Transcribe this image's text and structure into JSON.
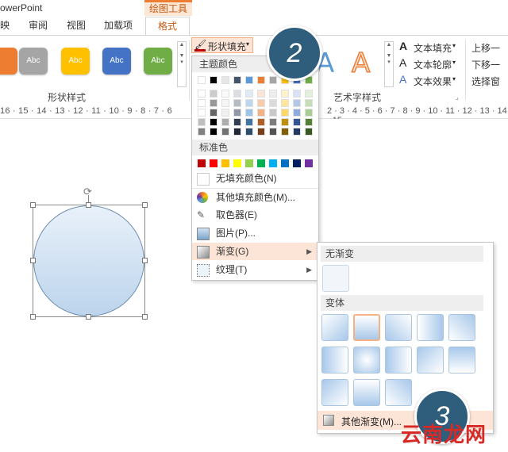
{
  "app": {
    "title": "owerPoint",
    "contextual_group": "绘图工具"
  },
  "tabs": [
    "映",
    "审阅",
    "视图",
    "加载项"
  ],
  "active_tab": "格式",
  "shape_styles": {
    "group_label": "形状样式",
    "buttons": [
      {
        "label": "",
        "color": "#ed7d31"
      },
      {
        "label": "Abc",
        "color": "#a5a5a5"
      },
      {
        "label": "Abc",
        "color": "#ffc000"
      },
      {
        "label": "Abc",
        "color": "#4472c4"
      },
      {
        "label": "Abc",
        "color": "#70ad47"
      }
    ]
  },
  "shape_fill_button": "形状填充",
  "wordart": {
    "group_label": "艺术字样式",
    "text_fill": "文本填充",
    "text_outline": "文本轮廓",
    "text_effects": "文本效果"
  },
  "arrange": {
    "bring_forward": "上移一",
    "send_backward": "下移一",
    "selection_pane": "选择窗"
  },
  "ruler_left": [
    "16",
    "15",
    "14",
    "13",
    "12",
    "11",
    "10",
    "9",
    "8",
    "7",
    "6"
  ],
  "ruler_right": [
    "2",
    "3",
    "4",
    "5",
    "6",
    "7",
    "8",
    "9",
    "10",
    "11",
    "12",
    "13",
    "14",
    "15"
  ],
  "fill_menu": {
    "theme_colors_header": "主题颜色",
    "theme_colors": [
      "#ffffff",
      "#000000",
      "#e7e6e6",
      "#44546a",
      "#5b9bd5",
      "#ed7d31",
      "#a5a5a5",
      "#ffc000",
      "#4472c4",
      "#70ad47"
    ],
    "standard_colors_header": "标准色",
    "standard_colors": [
      "#c00000",
      "#ff0000",
      "#ffc000",
      "#ffff00",
      "#92d050",
      "#00b050",
      "#00b0f0",
      "#0070c0",
      "#002060",
      "#7030a0"
    ],
    "items": [
      "无填充颜色(N)",
      "其他填充颜色(M)...",
      "取色器(E)",
      "图片(P)...",
      "渐变(G)",
      "纹理(T)"
    ]
  },
  "gradient_menu": {
    "no_gradient_header": "无渐变",
    "variants_header": "变体",
    "more_gradients": "其他渐变(M)..."
  },
  "callouts": [
    "2",
    "3"
  ],
  "watermark": "云南龙网"
}
